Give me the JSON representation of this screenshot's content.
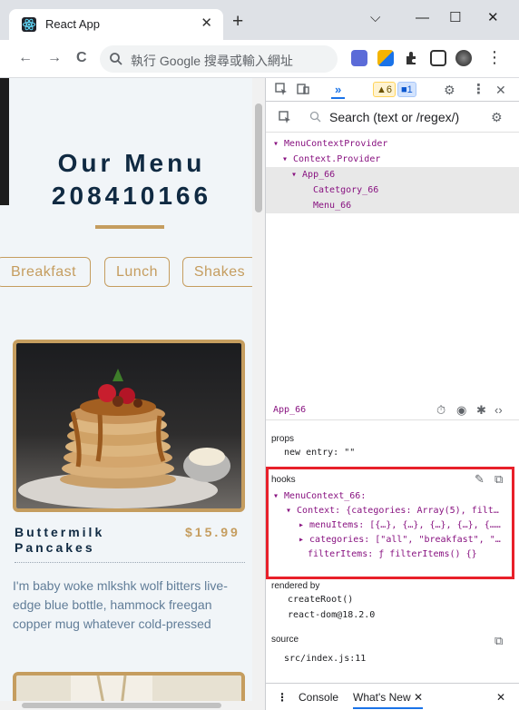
{
  "browser": {
    "tab_title": "React App",
    "tab_close": "✕",
    "new_tab": "+",
    "win_min": "—",
    "win_max": "☐",
    "win_close": "✕",
    "win_chevron": "⌵",
    "back": "←",
    "forward": "→",
    "reload": "C",
    "address_placeholder": "執行 Google 搜尋或輸入網址",
    "more_menu": "⋮"
  },
  "page": {
    "title_line1": "Our Menu",
    "title_line2": "208410166",
    "filters": [
      "Breakfast",
      "Lunch",
      "Shakes"
    ],
    "item": {
      "name": "Buttermilk Pancakes",
      "price": "$15.99",
      "description": "I'm baby woke mlkshk wolf bitters live-edge blue bottle, hammock freegan copper mug whatever cold-pressed"
    }
  },
  "devtools": {
    "more_tabs": "»",
    "warnings": "▲6",
    "messages": "■1",
    "search_placeholder": "Search (text or /regex/)",
    "tree": [
      {
        "label": "▾ MenuContextProvider",
        "depth": 0,
        "selected": false
      },
      {
        "label": "▾ Context.Provider",
        "depth": 1,
        "selected": false
      },
      {
        "label": "▾ App_66",
        "depth": 2,
        "selected": true
      },
      {
        "label": "Catetgory_66",
        "depth": 4,
        "selected": false
      },
      {
        "label": "Menu_66",
        "depth": 4,
        "selected": false
      }
    ],
    "selected_component": "App_66",
    "props_title": "props",
    "props_line": "new entry: \"\"",
    "hooks_title": "hooks",
    "hooks_lines": [
      "▾ MenuContext_66:",
      "▾ Context: {categories: Array(5), filt…",
      "▸ menuItems: [{…}, {…}, {…}, {…}, {……",
      "▸ categories: [\"all\", \"breakfast\", \"…",
      "filterItems: ƒ filterItems() {}"
    ],
    "rendered_by_title": "rendered by",
    "rendered_by": [
      "createRoot()",
      "react-dom@18.2.0"
    ],
    "source_title": "source",
    "source_file": "src/index.js:11",
    "drawer_tabs": [
      "Console",
      "What's New"
    ],
    "drawer_close": "✕"
  },
  "colors": {
    "accent": "#c59d5f",
    "heading": "#102a42",
    "hooks_highlight": "#e8202a"
  }
}
